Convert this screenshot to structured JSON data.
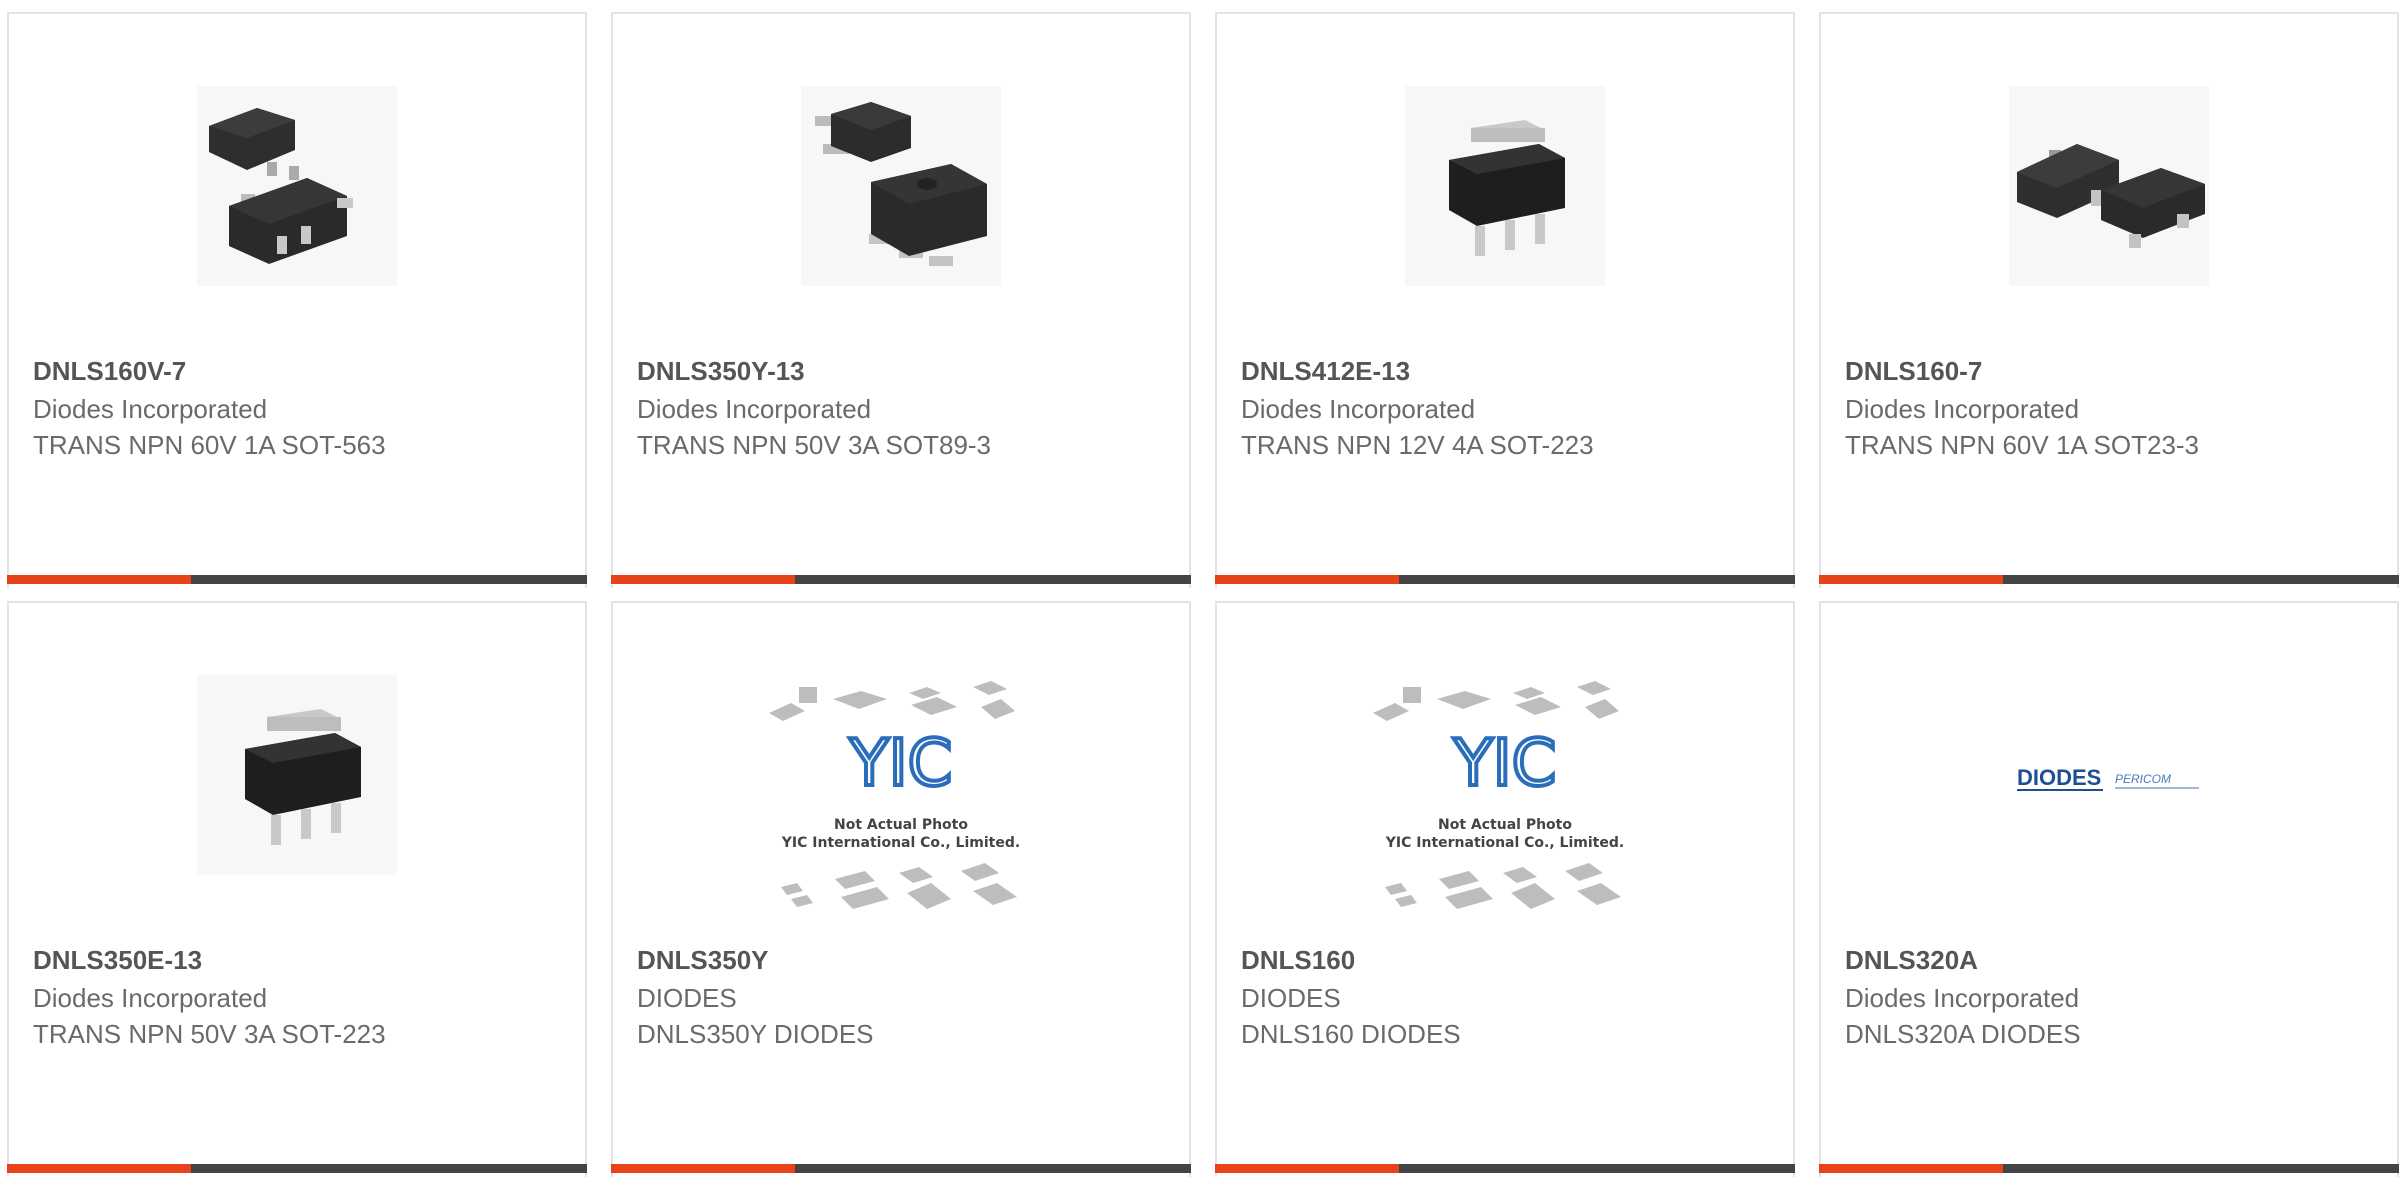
{
  "colors": {
    "accent": "#e8421a",
    "bar": "#444444",
    "border": "#e3e3e3",
    "part_number": "#555555",
    "text": "#6a6a6a"
  },
  "products": [
    {
      "part_number": "DNLS160V-7",
      "manufacturer": "Diodes Incorporated",
      "description": "TRANS NPN 60V 1A SOT-563",
      "image": "sot-563-package-icon"
    },
    {
      "part_number": "DNLS350Y-13",
      "manufacturer": "Diodes Incorporated",
      "description": "TRANS NPN 50V 3A SOT89-3",
      "image": "sot89-package-icon"
    },
    {
      "part_number": "DNLS412E-13",
      "manufacturer": "Diodes Incorporated",
      "description": "TRANS NPN 12V 4A SOT-223",
      "image": "sot-223-package-icon"
    },
    {
      "part_number": "DNLS160-7",
      "manufacturer": "Diodes Incorporated",
      "description": "TRANS NPN 60V 1A SOT23-3",
      "image": "sot23-package-icon"
    },
    {
      "part_number": "DNLS350E-13",
      "manufacturer": "Diodes Incorporated",
      "description": "TRANS NPN 50V 3A SOT-223",
      "image": "sot-223-package-icon"
    },
    {
      "part_number": "DNLS350Y",
      "manufacturer": "DIODES",
      "description": "DNLS350Y DIODES",
      "image": "not-actual-photo-placeholder",
      "photo_note_line1": "Not Actual Photo",
      "photo_note_line2": "YIC International Co., Limited.",
      "logo_text": "YIC"
    },
    {
      "part_number": "DNLS160",
      "manufacturer": "DIODES",
      "description": "DNLS160 DIODES",
      "image": "not-actual-photo-placeholder",
      "photo_note_line1": "Not Actual Photo",
      "photo_note_line2": "YIC International Co., Limited.",
      "logo_text": "YIC"
    },
    {
      "part_number": "DNLS320A",
      "manufacturer": "Diodes Incorporated",
      "description": "DNLS320A DIODES",
      "image": "diodes-pericom-logo",
      "logo_text_1": "DIODES",
      "logo_text_2": "PERICOM"
    }
  ]
}
